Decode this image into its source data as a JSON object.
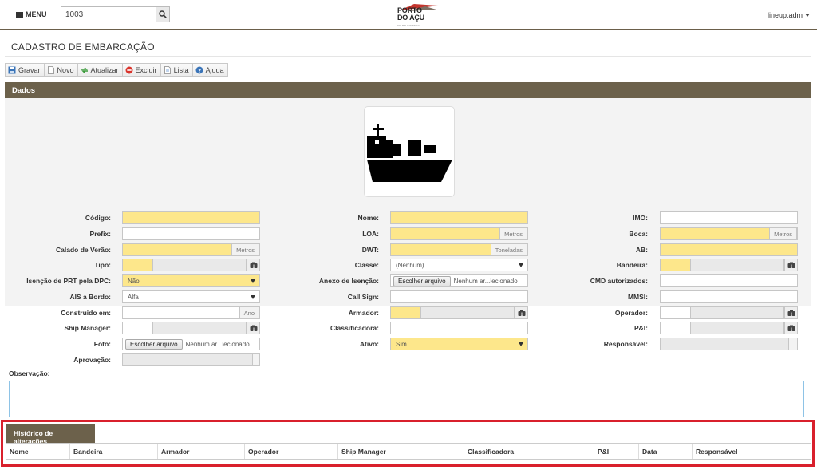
{
  "topbar": {
    "menu_label": "MENU",
    "search_value": "1003",
    "logo_line1": "PORTO",
    "logo_line2": "DO AÇU",
    "logo_sub": "GRUPO LOGÍSTICA",
    "user": "lineup.adm"
  },
  "page": {
    "title": "CADASTRO DE EMBARCAÇÃO"
  },
  "toolbar": {
    "save": "Gravar",
    "new": "Novo",
    "refresh": "Atualizar",
    "delete": "Excluir",
    "list": "Lista",
    "help": "Ajuda"
  },
  "section": {
    "title": "Dados"
  },
  "form": {
    "codigo": "Código:",
    "prefix": "Prefix:",
    "calado": "Calado de Verão:",
    "tipo": "Tipo:",
    "isencao": "Isenção de PRT pela DPC:",
    "isencao_value": "Não",
    "ais": "AIS a Bordo:",
    "ais_value": "Alfa",
    "construido": "Construido em:",
    "ship_manager": "Ship Manager:",
    "foto": "Foto:",
    "aprovacao": "Aprovação:",
    "nome": "Nome:",
    "loa": "LOA:",
    "dwt": "DWT:",
    "classe": "Classe:",
    "classe_value": "(Nenhum)",
    "anexo": "Anexo de Isenção:",
    "call_sign": "Call Sign:",
    "armador": "Armador:",
    "classificadora": "Classificadora:",
    "ativo": "Ativo:",
    "ativo_value": "Sim",
    "imo": "IMO:",
    "boca": "Boca:",
    "ab": "AB:",
    "bandeira": "Bandeira:",
    "cmd": "CMD autorizados:",
    "mmsi": "MMSI:",
    "operador": "Operador:",
    "pi": "P&I:",
    "responsavel": "Responsável:",
    "unit_metros": "Metros",
    "unit_toneladas": "Toneladas",
    "unit_ano": "Ano",
    "file_button": "Escolher arquivo",
    "file_none": "Nenhum ar...lecionado",
    "observacao": "Observação:"
  },
  "history": {
    "tab": "Histórico de alterações",
    "columns": [
      "Nome",
      "Bandeira",
      "Armador",
      "Operador",
      "Ship Manager",
      "Classificadora",
      "P&I",
      "Data",
      "Responsável"
    ]
  },
  "colors": {
    "brand": "#6c614b",
    "required": "#fde78b",
    "highlight": "#d9202c"
  }
}
